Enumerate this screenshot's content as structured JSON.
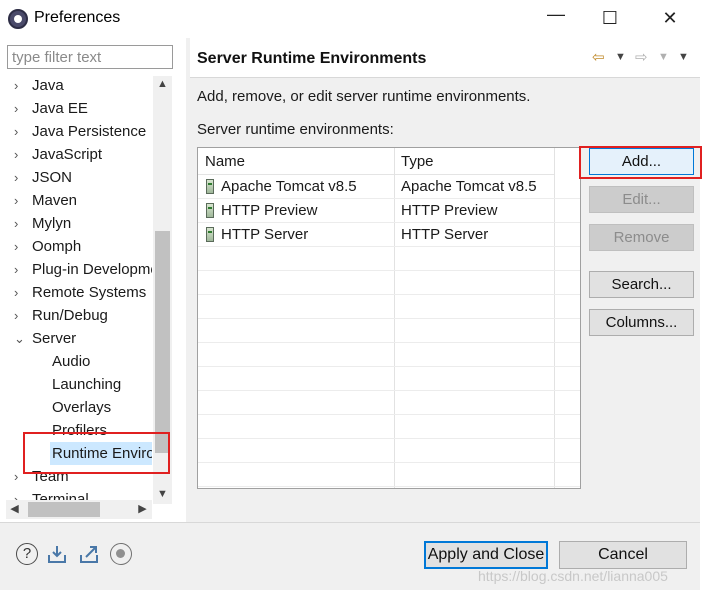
{
  "window": {
    "title": "Preferences",
    "minimize": "—",
    "maximize": "☐",
    "close": "✕"
  },
  "filter": {
    "placeholder": "type filter text"
  },
  "tree": [
    {
      "label": "Java",
      "twisty": "›"
    },
    {
      "label": "Java EE",
      "twisty": "›"
    },
    {
      "label": "Java Persistence",
      "twisty": "›"
    },
    {
      "label": "JavaScript",
      "twisty": "›"
    },
    {
      "label": "JSON",
      "twisty": "›"
    },
    {
      "label": "Maven",
      "twisty": "›"
    },
    {
      "label": "Mylyn",
      "twisty": "›"
    },
    {
      "label": "Oomph",
      "twisty": "›"
    },
    {
      "label": "Plug-in Development",
      "twisty": "›"
    },
    {
      "label": "Remote Systems",
      "twisty": "›"
    },
    {
      "label": "Run/Debug",
      "twisty": "›"
    },
    {
      "label": "Server",
      "twisty": "⌄",
      "expanded": true
    },
    {
      "label": "Audio",
      "child": true
    },
    {
      "label": "Launching",
      "child": true
    },
    {
      "label": "Overlays",
      "child": true
    },
    {
      "label": "Profilers",
      "child": true
    },
    {
      "label": "Runtime Environments",
      "child": true,
      "selected": true
    },
    {
      "label": "Team",
      "twisty": "›"
    },
    {
      "label": "Terminal",
      "twisty": "›"
    }
  ],
  "page": {
    "title": "Server Runtime Environments",
    "description": "Add, remove, or edit server runtime environments.",
    "list_label": "Server runtime environments:"
  },
  "table": {
    "columns": [
      "Name",
      "Type"
    ],
    "rows": [
      {
        "name": "Apache Tomcat v8.5",
        "type": "Apache Tomcat v8.5"
      },
      {
        "name": "HTTP Preview",
        "type": "HTTP Preview"
      },
      {
        "name": "HTTP Server",
        "type": "HTTP Server"
      }
    ]
  },
  "buttons": {
    "add": "Add...",
    "edit": "Edit...",
    "remove": "Remove",
    "search": "Search...",
    "columns": "Columns..."
  },
  "footer": {
    "apply_close": "Apply and Close",
    "cancel": "Cancel",
    "help_glyph": "?"
  },
  "watermark": "https://blog.csdn.net/lianna005",
  "colors": {
    "highlight": "#e02020",
    "selection": "#cce8ff",
    "focus": "#0078d7"
  },
  "icons": [
    "eclipse-icon",
    "back-arrow-icon",
    "forward-arrow-icon",
    "help-icon",
    "import-icon",
    "export-icon",
    "record-icon",
    "server-runtime-icon"
  ]
}
